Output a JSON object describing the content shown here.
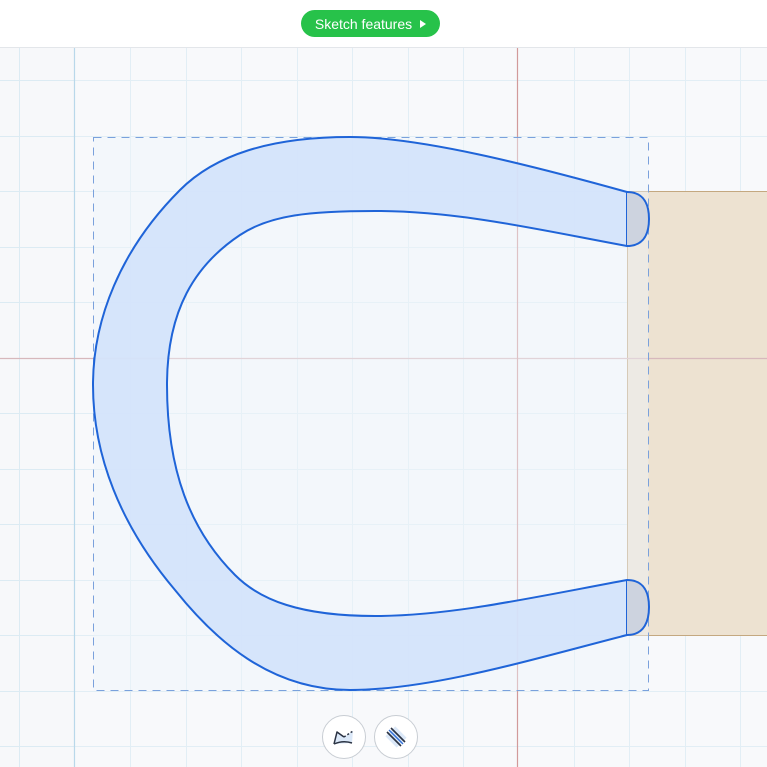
{
  "toolbar": {
    "sketch_features_label": "Sketch features"
  },
  "icons": {
    "sketch_features_arrow": "play-triangle-icon",
    "sketch_tool": "sketch-polyline-icon",
    "pattern_tool": "hatch-lines-icon"
  },
  "colors": {
    "accent_green": "#27c24a",
    "sketch_stroke": "#1f64d8",
    "profile_fill": "#d4e3fb",
    "body_fill": "#ede2d1",
    "grid_line": "#dcebf3",
    "axis_red": "#d29a9a"
  }
}
